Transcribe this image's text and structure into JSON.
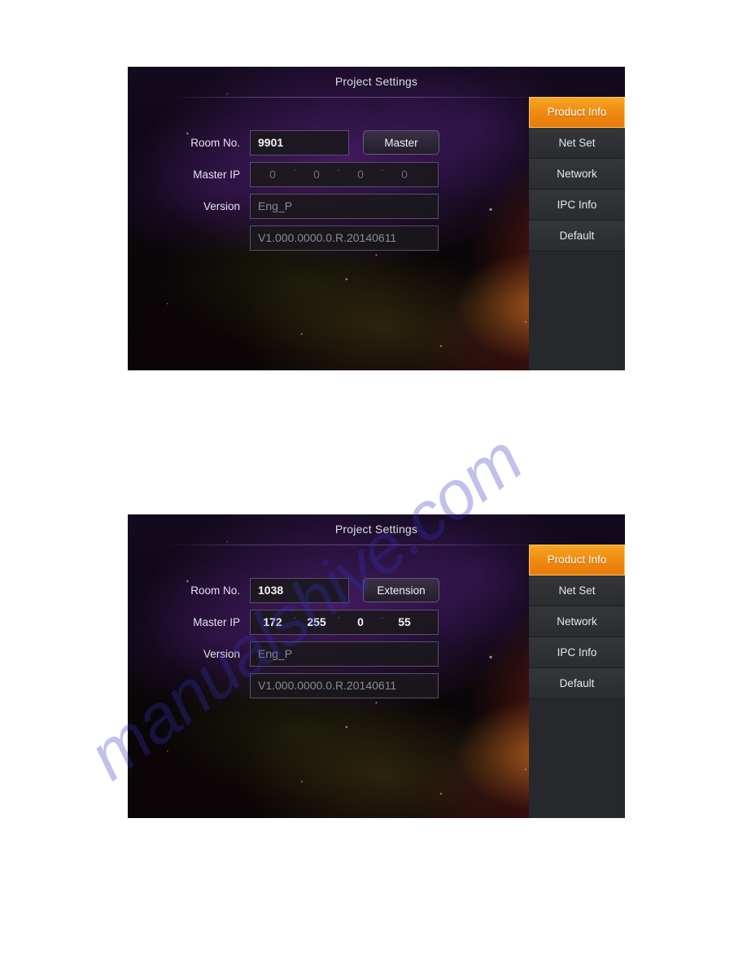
{
  "page": {
    "watermark": "manualshive.com"
  },
  "panels": [
    {
      "id": "panel-top",
      "title": "Project Settings",
      "fields": {
        "room_label": "Room No.",
        "room_value": "9901",
        "role_button": "Master",
        "master_ip_label": "Master IP",
        "master_ip": [
          "0",
          "0",
          "0",
          "0"
        ],
        "ip_separator": "·",
        "version_label": "Version",
        "version_value": "Eng_P",
        "build_value": "V1.000.0000.0.R.20140611"
      },
      "menu": [
        {
          "label": "Product Info",
          "active": true
        },
        {
          "label": "Net Set",
          "active": false
        },
        {
          "label": "Network",
          "active": false
        },
        {
          "label": "IPC Info",
          "active": false
        },
        {
          "label": "Default",
          "active": false
        }
      ]
    },
    {
      "id": "panel-bot",
      "title": "Project Settings",
      "fields": {
        "room_label": "Room No.",
        "room_value": "1038",
        "role_button": "Extension",
        "master_ip_label": "Master IP",
        "master_ip": [
          "172",
          "255",
          "0",
          "55"
        ],
        "ip_separator": "·",
        "version_label": "Version",
        "version_value": "Eng_P",
        "build_value": "V1.000.0000.0.R.20140611"
      },
      "menu": [
        {
          "label": "Product Info",
          "active": true
        },
        {
          "label": "Net Set",
          "active": false
        },
        {
          "label": "Network",
          "active": false
        },
        {
          "label": "IPC Info",
          "active": false
        },
        {
          "label": "Default",
          "active": false
        }
      ]
    }
  ],
  "colors": {
    "accent_orange": "#ef8a12",
    "menu_gray": "#2a2c2f",
    "field_border": "#84709c",
    "text_primary": "#f2f2f6",
    "text_muted": "#8c8a95"
  }
}
